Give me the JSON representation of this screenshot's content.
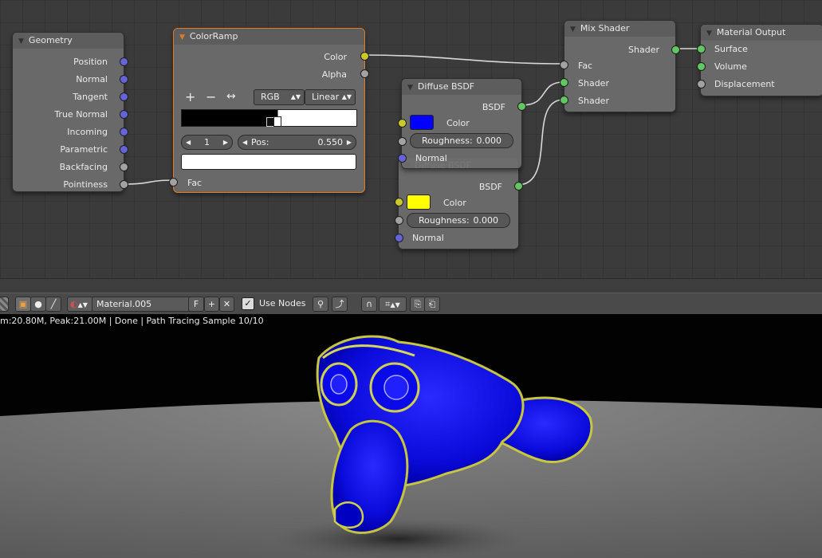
{
  "nodes": {
    "geometry": {
      "title": "Geometry",
      "outputs": [
        "Position",
        "Normal",
        "Tangent",
        "True Normal",
        "Incoming",
        "Parametric",
        "Backfacing",
        "Pointiness"
      ]
    },
    "colorramp": {
      "title": "ColorRamp",
      "out_color": "Color",
      "out_alpha": "Alpha",
      "add_label": "+",
      "remove_label": "−",
      "flip_label": "↔",
      "color_mode": "RGB",
      "interpolation": "Linear",
      "stop_index": "1",
      "pos_label": "Pos:",
      "pos_value": "0.550",
      "in_fac": "Fac"
    },
    "mix_shader": {
      "title": "Mix Shader",
      "out_shader": "Shader",
      "in_fac": "Fac",
      "in_shader1": "Shader",
      "in_shader2": "Shader"
    },
    "material_output": {
      "title": "Material Output",
      "in_surface": "Surface",
      "in_volume": "Volume",
      "in_displacement": "Displacement"
    },
    "diffuse1": {
      "title": "Diffuse BSDF",
      "out_bsdf": "BSDF",
      "color_label": "Color",
      "color_value": "#0000ff",
      "roughness_label": "Roughness:",
      "roughness_value": "0.000",
      "normal_label": "Normal"
    },
    "diffuse2": {
      "title": "Diffuse BSDF",
      "out_bsdf": "BSDF",
      "color_label": "Color",
      "color_value": "#ffff00",
      "roughness_label": "Roughness:",
      "roughness_value": "0.000",
      "normal_label": "Normal"
    }
  },
  "header": {
    "material_name": "Material.005",
    "fake_user": "F",
    "new_icon": "plus-icon",
    "unlink_icon": "x-icon",
    "use_nodes_label": "Use Nodes",
    "use_nodes_checked": true
  },
  "viewport": {
    "status_text": "m:20.80M, Peak:21.00M | Done | Path Tracing Sample 10/10"
  },
  "colors": {
    "active_node_border": "#e07b22",
    "socket_vector": "#6464d8",
    "socket_float": "#a2a2a2",
    "socket_color": "#cbc82a",
    "socket_shader": "#62c662"
  }
}
